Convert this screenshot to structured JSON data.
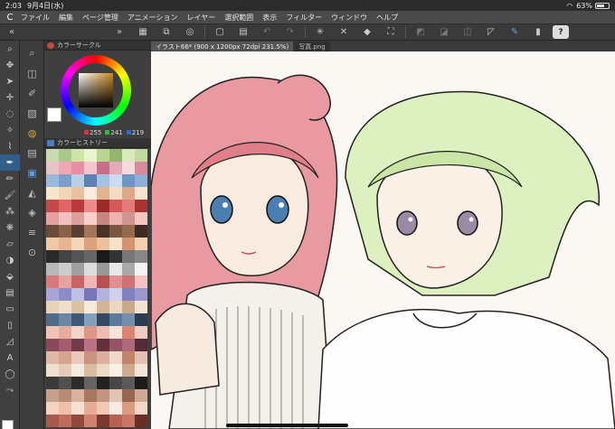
{
  "status": {
    "time": "2:03",
    "date": "9月4日(水)",
    "battery": "63%"
  },
  "menu": {
    "logo": "C",
    "items": [
      "ファイル",
      "編集",
      "ページ管理",
      "アニメーション",
      "レイヤー",
      "選択範囲",
      "表示",
      "フィルター",
      "ウィンドウ",
      "ヘルプ"
    ]
  },
  "toolbar": {
    "help_label": "?",
    "buttons": [
      "grid-icon",
      "navigator-icon",
      "zoom-fit-icon",
      "new-icon",
      "open-icon",
      "save-icon",
      "undo-icon",
      "redo-icon",
      "transform-icon",
      "clear-icon",
      "fill-icon",
      "crop-icon",
      "ruler-icon",
      "snap-icon",
      "symmetry-icon",
      "perspective-icon",
      "pen-pressure-icon"
    ]
  },
  "panels": {
    "color_circle": {
      "title": "カラーサークル",
      "r": "255",
      "g": "241",
      "b": "219"
    },
    "color_history": {
      "title": "カラーヒストリー"
    }
  },
  "document": {
    "tabs": [
      {
        "label": "イラスト66* (900 x 1200px 72dpi 231.5%)",
        "active": true
      },
      {
        "label": "写真.png",
        "active": false
      }
    ]
  },
  "colors": {
    "accent": "#2f5f8a",
    "history_swatches": [
      "#c9d9b2",
      "#a8c98a",
      "#cfe5a8",
      "#e8f4c9",
      "#b9d68f",
      "#94b56c",
      "#d9e8bd",
      "#c2d9a0",
      "#e7c3c8",
      "#f0a7b5",
      "#e88ea3",
      "#f3c6cf",
      "#c96e8a",
      "#e3aab9",
      "#f5d9de",
      "#d8899c",
      "#9bb9d8",
      "#7aa0c9",
      "#b8d0e6",
      "#5b82b0",
      "#a3c3e0",
      "#c8dcee",
      "#6e96c4",
      "#8fb0d6",
      "#f6e6d0",
      "#f2d4b8",
      "#e8c1a0",
      "#f9ebdd",
      "#e5b28f",
      "#f4dcc3",
      "#dca988",
      "#f7e3cf",
      "#c44a4a",
      "#e06666",
      "#b93a3a",
      "#f08a8a",
      "#9c2a2a",
      "#d45959",
      "#e57a7a",
      "#a83333",
      "#e6a0a0",
      "#f3c0bd",
      "#dca09a",
      "#f7d0cc",
      "#c98580",
      "#eab3ad",
      "#d09590",
      "#f4c6c0",
      "#6b4b3a",
      "#8a6248",
      "#5a3e2f",
      "#a27656",
      "#4a3226",
      "#7b573f",
      "#936a4e",
      "#3e2a20",
      "#f0c8a6",
      "#e7b48f",
      "#f5d6bb",
      "#dca07c",
      "#eec09c",
      "#f8e0c9",
      "#d2946f",
      "#f2cfb1",
      "#2a2a2a",
      "#444444",
      "#555555",
      "#666666",
      "#1a1a1a",
      "#333333",
      "#777777",
      "#888888",
      "#b8b8b8",
      "#cccccc",
      "#a0a0a0",
      "#dddddd",
      "#999999",
      "#e8e8e8",
      "#aaaaaa",
      "#f4f4f4",
      "#d97a7a",
      "#e8a29e",
      "#c96262",
      "#f0b8b4",
      "#b85050",
      "#e09090",
      "#cf7272",
      "#f3c4c0",
      "#a6a6d8",
      "#8c8cc9",
      "#c0c0e6",
      "#7676b8",
      "#b3b3df",
      "#d0d0ee",
      "#8080c0",
      "#9999cf",
      "#e8d2b8",
      "#f0dfc8",
      "#dcc2a4",
      "#f6ead8",
      "#d2b594",
      "#ecd8bf",
      "#c8aa86",
      "#f3e4d0",
      "#4f6b8a",
      "#6a87a8",
      "#3d5878",
      "#85a0be",
      "#33495f",
      "#5c7a9b",
      "#748fae",
      "#2a3c50",
      "#f2c2b6",
      "#e9ab9b",
      "#f6d3ca",
      "#df9784",
      "#efbdaf",
      "#f9e2da",
      "#d88670",
      "#f4cbbf",
      "#8a4a5a",
      "#a35d6e",
      "#733b49",
      "#b97384",
      "#63313d",
      "#965366",
      "#ad6a7b",
      "#552a34",
      "#e0b8a8",
      "#d6a592",
      "#eac9bc",
      "#cc937e",
      "#dcb09e",
      "#f0d8cd",
      "#c2836c",
      "#e6c0b2",
      "#efe0d0",
      "#e4ccb6",
      "#f5eadf",
      "#dabba0",
      "#ecd9c6",
      "#f9f1e8",
      "#d0aa8c",
      "#f2e4d6",
      "#3a3a3a",
      "#505050",
      "#2c2c2c",
      "#646464",
      "#222222",
      "#474747",
      "#5a5a5a",
      "#1c1c1c",
      "#c9a08a",
      "#b88c74",
      "#d8b4a0",
      "#a7785f",
      "#c29580",
      "#e2c4b3",
      "#96684f",
      "#d0a994",
      "#f5d2c2",
      "#eebfab",
      "#f9e0d4",
      "#e6ac95",
      "#f2c9b7",
      "#fbeae1",
      "#dd9a80",
      "#f4d6c8",
      "#a85a4a",
      "#c06c5a",
      "#92483a",
      "#d28070",
      "#7c382c",
      "#b66252",
      "#ca7767",
      "#6a2e24"
    ]
  }
}
